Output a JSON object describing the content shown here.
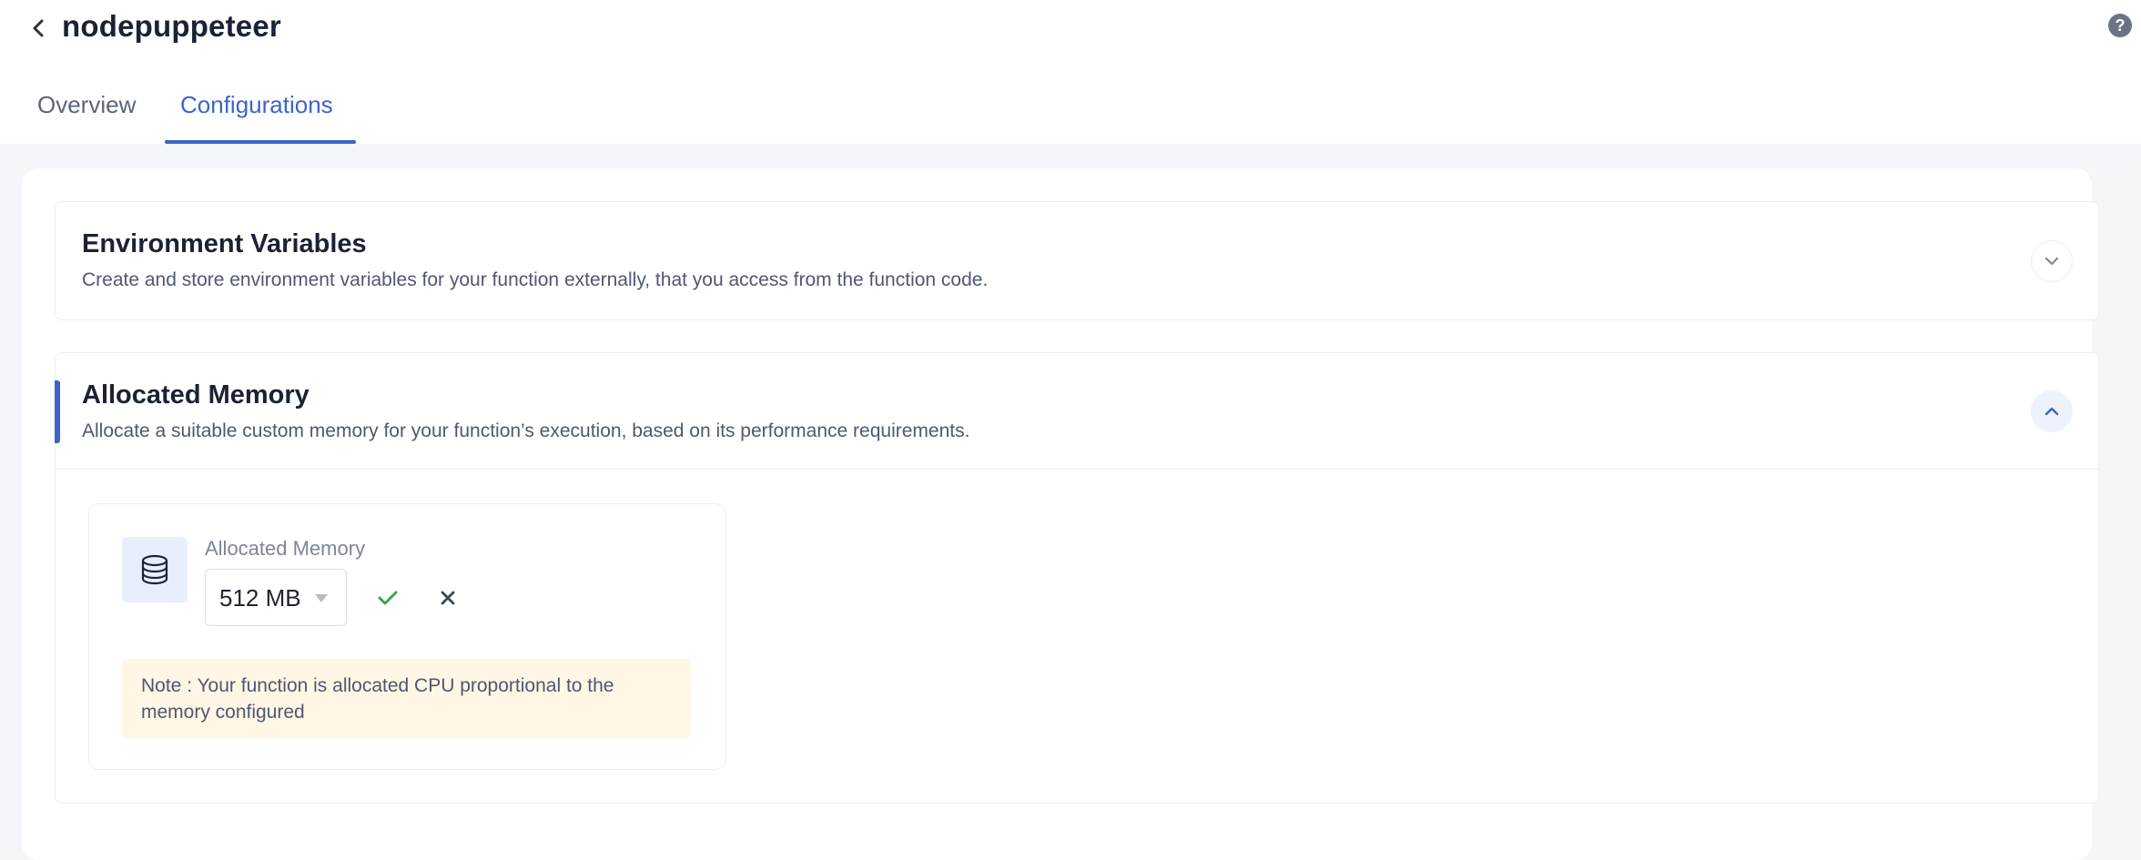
{
  "header": {
    "title": "nodepuppeteer",
    "back_icon": "chevron-left-icon",
    "help_icon_glyph": "?"
  },
  "tabs": [
    {
      "label": "Overview",
      "active": false
    },
    {
      "label": "Configurations",
      "active": true
    }
  ],
  "sections": {
    "environment_variables": {
      "title": "Environment Variables",
      "description": "Create and store environment variables for your function externally, that you access from the function code.",
      "expanded": false
    },
    "allocated_memory": {
      "title": "Allocated Memory",
      "description": "Allocate a suitable custom memory for your function’s execution, based on its performance requirements.",
      "expanded": true,
      "field_label": "Allocated Memory",
      "selected_value": "512 MB",
      "note": "Note : Your function is allocated CPU proportional to the memory configured"
    }
  },
  "colors": {
    "accent": "#3c64c8",
    "confirm": "#3aa655",
    "note_background": "#fff6e5"
  }
}
